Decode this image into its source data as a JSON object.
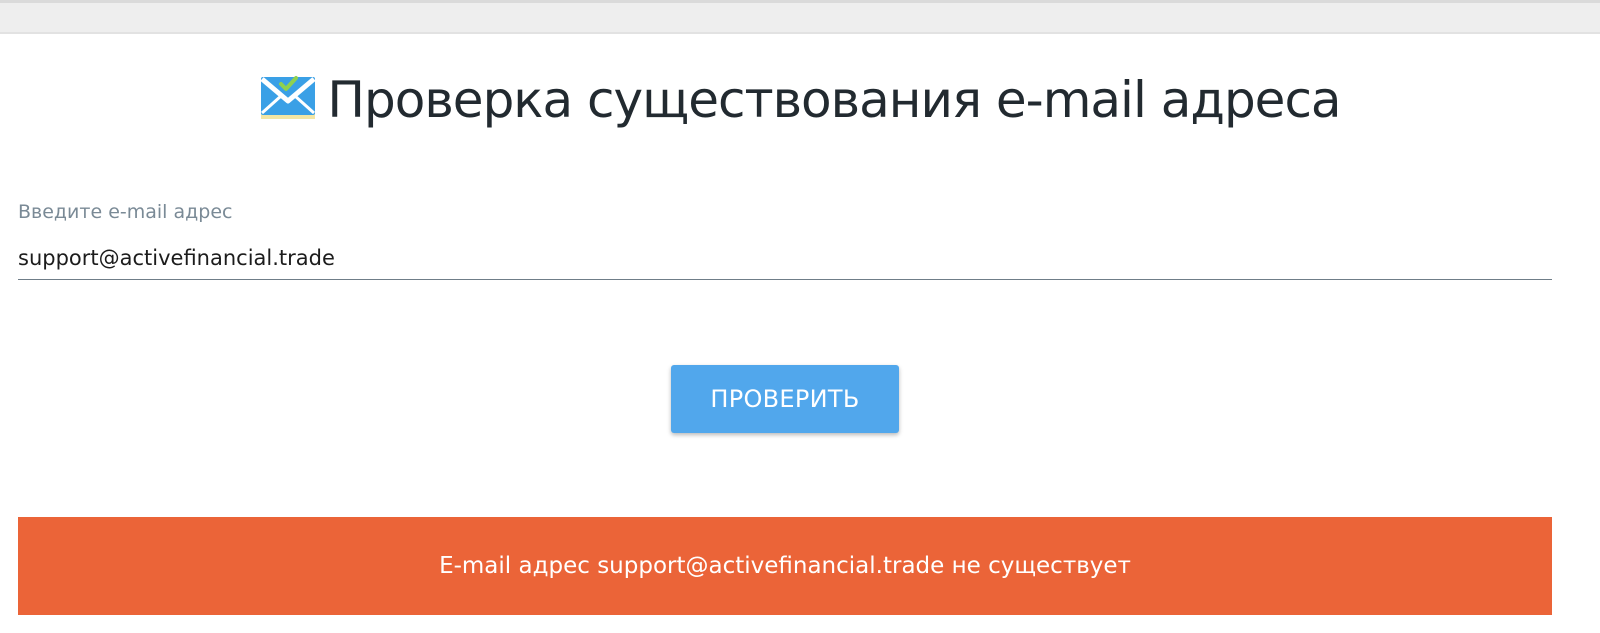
{
  "page": {
    "title": "Проверка существования e-mail адреса",
    "title_icon": "envelope-check-icon"
  },
  "form": {
    "email_label": "Введите e-mail адрес",
    "email_value": "support@activefinancial.trade",
    "submit_label": "ПРОВЕРИТЬ"
  },
  "result": {
    "message": "E-mail адрес support@activefinancial.trade не существует",
    "status": "not-exists"
  },
  "colors": {
    "button": "#51a7ec",
    "error_banner": "#eb6438",
    "title_text": "#222a30",
    "label_text": "#7a8a96"
  }
}
